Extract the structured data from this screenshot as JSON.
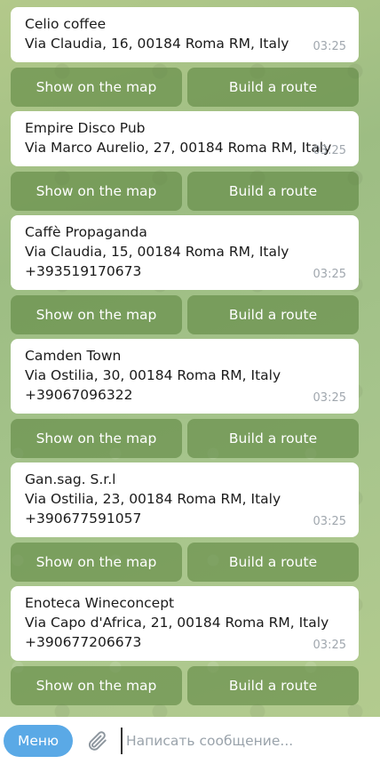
{
  "messages": [
    {
      "name": "Celio coffee",
      "address": "Via Claudia, 16, 00184 Roma RM, Italy",
      "phone": "",
      "time": "03:25",
      "show_label": "Show on the map",
      "route_label": "Build a route"
    },
    {
      "name": "Empire Disco Pub",
      "address": "Via Marco Aurelio, 27, 00184 Roma RM, Italy",
      "phone": "",
      "time": "03:25",
      "show_label": "Show on the map",
      "route_label": "Build a route"
    },
    {
      "name": "Caffè Propaganda",
      "address": "Via Claudia, 15, 00184 Roma RM, Italy",
      "phone": "+393519170673",
      "time": "03:25",
      "show_label": "Show on the map",
      "route_label": "Build a route"
    },
    {
      "name": "Camden Town",
      "address": "Via Ostilia, 30, 00184 Roma RM, Italy",
      "phone": "+39067096322",
      "time": "03:25",
      "show_label": "Show on the map",
      "route_label": "Build a route"
    },
    {
      "name": "Gan.sag. S.r.l",
      "address": "Via Ostilia, 23, 00184 Roma RM, Italy",
      "phone": "+390677591057",
      "time": "03:25",
      "show_label": "Show on the map",
      "route_label": "Build a route"
    },
    {
      "name": "Enoteca Wineconcept",
      "address": "Via Capo d'Africa, 21, 00184 Roma RM, Italy",
      "phone": "+390677206673",
      "time": "03:25",
      "show_label": "Show on the map",
      "route_label": "Build a route"
    }
  ],
  "composer": {
    "menu_label": "Меню",
    "placeholder": "Написать сообщение...",
    "attach_icon": "paperclip-icon"
  },
  "colors": {
    "accent": "#5aa9e6",
    "button_bg": "#6f9a4f",
    "background": "#a6c48c"
  }
}
